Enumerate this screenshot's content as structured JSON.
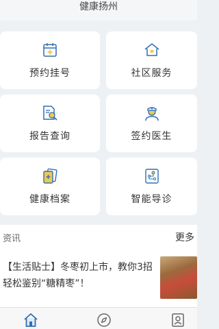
{
  "header": {
    "title": "健康扬州"
  },
  "services": [
    {
      "label": "预约挂号",
      "icon": "calendar-plus-icon"
    },
    {
      "label": "社区服务",
      "icon": "home-heart-icon"
    },
    {
      "label": "报告查询",
      "icon": "document-search-icon"
    },
    {
      "label": "签约医生",
      "icon": "doctor-icon"
    },
    {
      "label": "健康档案",
      "icon": "health-records-icon"
    },
    {
      "label": "智能导诊",
      "icon": "smart-guide-icon"
    }
  ],
  "news": {
    "title": "资讯",
    "more": "更多",
    "items": [
      {
        "text": "【生活贴士】冬枣初上市，教你3招轻松鉴别“糖精枣”！"
      }
    ]
  },
  "tabbar": {
    "items": [
      {
        "icon": "home-icon",
        "active": true
      },
      {
        "icon": "compass-icon",
        "active": false
      },
      {
        "icon": "profile-icon",
        "active": false
      }
    ]
  },
  "colors": {
    "accent": "#2f6fb5",
    "icon_yellow": "#f2c94c",
    "page_bg": "#eef1f4"
  }
}
